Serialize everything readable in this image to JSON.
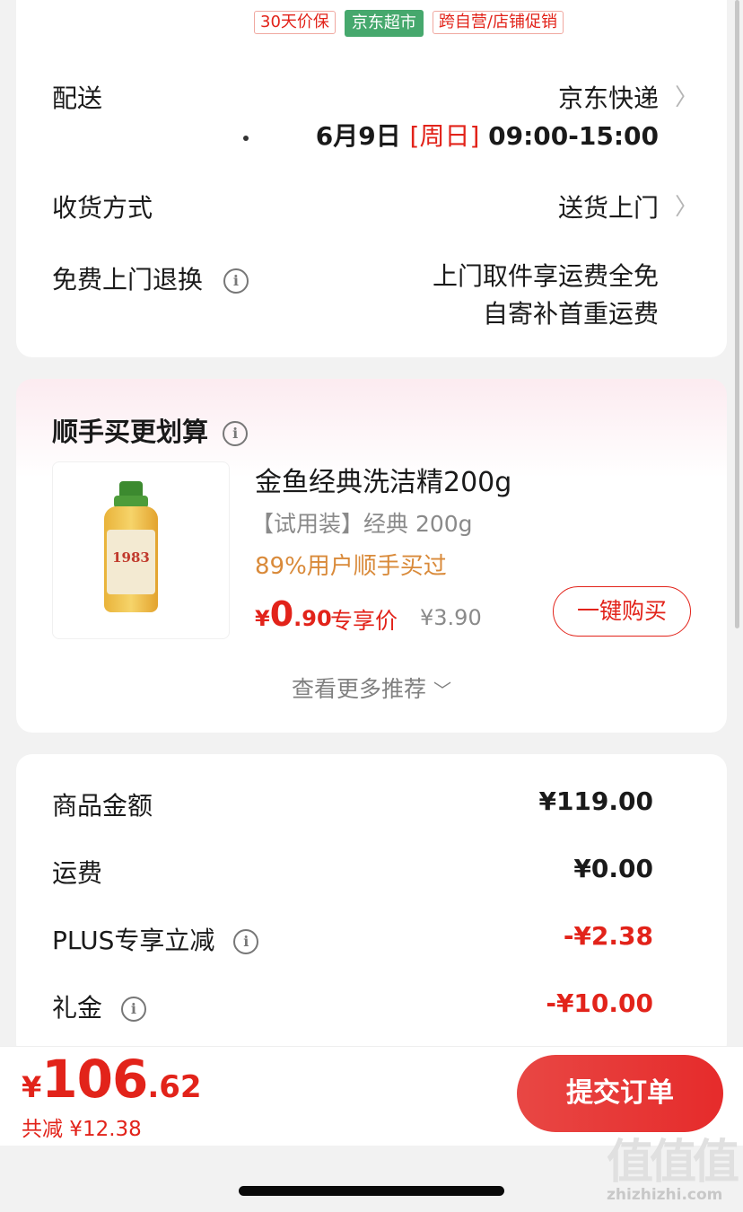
{
  "tags": [
    "30天价保",
    "京东超市",
    "跨自营/店铺促销"
  ],
  "delivery": {
    "label": "配送",
    "carrier": "京东快递",
    "date": "6月9日",
    "weekday": "[周日]",
    "time": "09:00-15:00"
  },
  "receive": {
    "label": "收货方式",
    "value": "送货上门"
  },
  "returns": {
    "label": "免费上门退换",
    "line1": "上门取件享运费全免",
    "line2": "自寄补首重运费"
  },
  "addon": {
    "title": "顺手买更划算",
    "product": {
      "title": "金鱼经典洗洁精200g",
      "subtitle": "【试用装】经典 200g",
      "bought": "89%用户顺手买过",
      "currency": "¥",
      "price_int": "0",
      "price_dec": ".90",
      "exclusive": "专享价",
      "original": "¥3.90",
      "label_text": "1983",
      "buy_label": "一键购买"
    },
    "more_label": "查看更多推荐"
  },
  "summary": {
    "rows": [
      {
        "label": "商品金额",
        "value": "¥119.00"
      },
      {
        "label": "运费",
        "value": "¥0.00"
      },
      {
        "label": "PLUS专享立减",
        "value": "-¥2.38"
      },
      {
        "label": "礼金",
        "value": "-¥10.00"
      }
    ]
  },
  "footer": {
    "currency": "¥",
    "total_int": "106",
    "total_dec": ".62",
    "saved": "共减 ¥12.38",
    "submit_label": "提交订单"
  },
  "watermark": {
    "glyphs": "值值值",
    "url": "zhizhizhi.com"
  },
  "colors": {
    "accent": "#e2231a",
    "green_tag": "#46a86d",
    "orange": "#d98a3a"
  }
}
